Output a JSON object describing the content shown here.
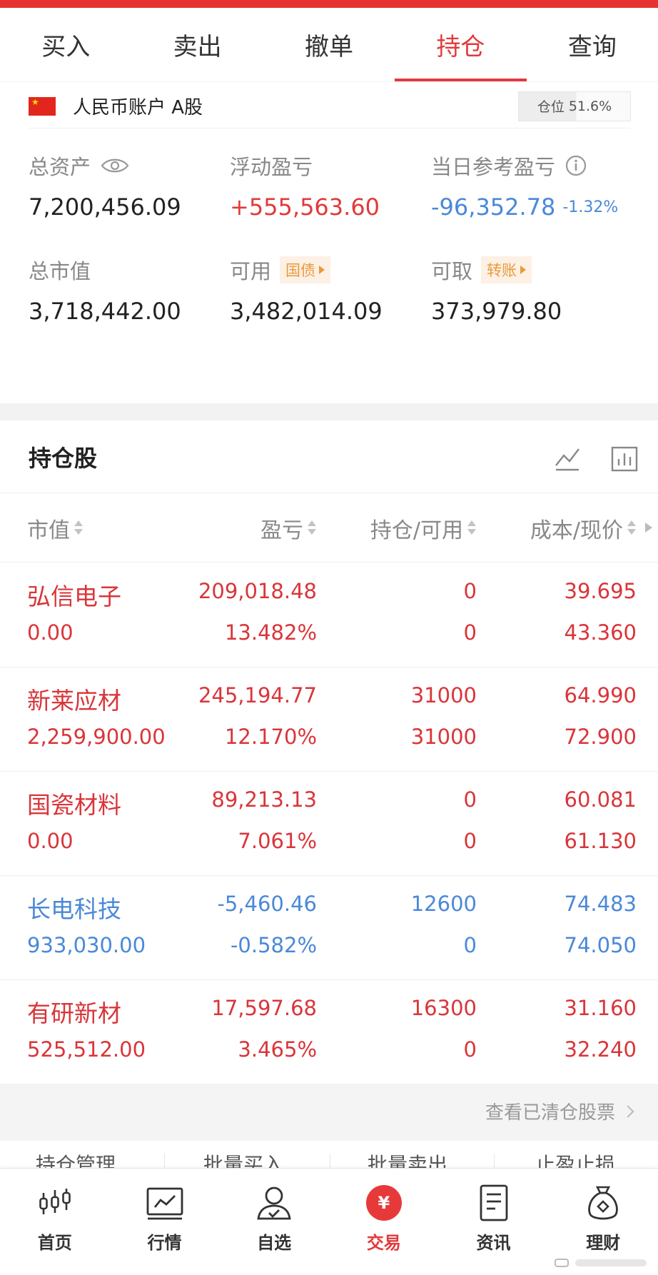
{
  "tabs": [
    {
      "label": "买入",
      "active": false
    },
    {
      "label": "卖出",
      "active": false
    },
    {
      "label": "撤单",
      "active": false
    },
    {
      "label": "持仓",
      "active": true
    },
    {
      "label": "查询",
      "active": false
    }
  ],
  "account": {
    "name": "人民币账户 A股",
    "position_label": "仓位",
    "position_value": "51.6%",
    "position_ratio": 0.516
  },
  "summary": {
    "total_assets": {
      "label": "总资产",
      "value": "7,200,456.09"
    },
    "floating_pl": {
      "label": "浮动盈亏",
      "value": "+555,563.60"
    },
    "daily_pl": {
      "label": "当日参考盈亏",
      "value": "-96,352.78",
      "pct": "-1.32%"
    },
    "market_value": {
      "label": "总市值",
      "value": "3,718,442.00"
    },
    "available": {
      "label": "可用",
      "tag": "国债",
      "value": "3,482,014.09"
    },
    "withdrawable": {
      "label": "可取",
      "tag": "转账",
      "value": "373,979.80"
    }
  },
  "holdings": {
    "title": "持仓股",
    "columns": [
      "市值",
      "盈亏",
      "持仓/可用",
      "成本/现价"
    ],
    "rows": [
      {
        "name": "弘信电子",
        "market_value": "0.00",
        "pl": "209,018.48",
        "pl_pct": "13.482%",
        "position": "0",
        "available": "0",
        "cost": "39.695",
        "price": "43.360",
        "color": "red"
      },
      {
        "name": "新莱应材",
        "market_value": "2,259,900.00",
        "pl": "245,194.77",
        "pl_pct": "12.170%",
        "position": "31000",
        "available": "31000",
        "cost": "64.990",
        "price": "72.900",
        "color": "red"
      },
      {
        "name": "国瓷材料",
        "market_value": "0.00",
        "pl": "89,213.13",
        "pl_pct": "7.061%",
        "position": "0",
        "available": "0",
        "cost": "60.081",
        "price": "61.130",
        "color": "red"
      },
      {
        "name": "长电科技",
        "market_value": "933,030.00",
        "pl": "-5,460.46",
        "pl_pct": "-0.582%",
        "position": "12600",
        "available": "0",
        "cost": "74.483",
        "price": "74.050",
        "color": "blue"
      },
      {
        "name": "有研新材",
        "market_value": "525,512.00",
        "pl": "17,597.68",
        "pl_pct": "3.465%",
        "position": "16300",
        "available": "0",
        "cost": "31.160",
        "price": "32.240",
        "color": "red"
      }
    ],
    "view_cleared": "查看已清仓股票"
  },
  "bottom_nav": [
    {
      "label": "首页",
      "icon": "candlestick-icon",
      "active": false
    },
    {
      "label": "行情",
      "icon": "chart-icon",
      "active": false
    },
    {
      "label": "自选",
      "icon": "user-check-icon",
      "active": false
    },
    {
      "label": "交易",
      "icon": "yen-icon",
      "active": true,
      "glyph": "¥"
    },
    {
      "label": "资讯",
      "icon": "document-icon",
      "active": false
    },
    {
      "label": "理财",
      "icon": "money-bag-icon",
      "active": false
    }
  ],
  "colors": {
    "accent": "#e2393a",
    "up": "#d9353a",
    "down": "#4a89d8",
    "tag": "#e99a3c"
  }
}
